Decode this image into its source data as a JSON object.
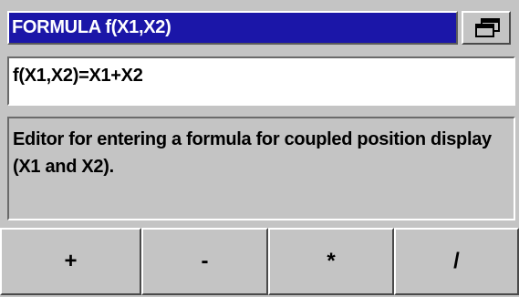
{
  "title_bar": {
    "title": "FORMULA f(X1,X2)",
    "window_button_icon": "window-switch-icon"
  },
  "formula": {
    "value": "f(X1,X2)=X1+X2"
  },
  "help": {
    "text": "Editor for entering a formula for coupled position display (X1 and X2)."
  },
  "softkeys": [
    {
      "label": "+"
    },
    {
      "label": "-"
    },
    {
      "label": "*"
    },
    {
      "label": "/"
    }
  ],
  "colors": {
    "title_bar_bg": "#1b16a8",
    "panel_bg": "#c4c4c4",
    "field_bg": "#ffffff"
  }
}
